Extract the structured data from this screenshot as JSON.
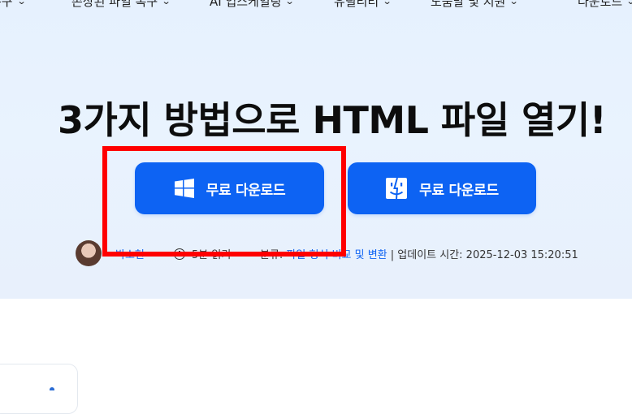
{
  "nav": {
    "items": [
      {
        "label": "복구"
      },
      {
        "label": "손상된 파일 복구"
      },
      {
        "label": "AI 업스케일링"
      },
      {
        "label": "유틸리티"
      },
      {
        "label": "도움말 및 지원"
      },
      {
        "label": "다운로드"
      }
    ]
  },
  "hero": {
    "title": "3가지 방법으로 HTML 파일 열기!",
    "buttons": {
      "windows_label": "무료 다운로드",
      "mac_label": "무료 다운로드"
    }
  },
  "meta": {
    "author": "박소현",
    "read_time": "5분 읽기",
    "category_prefix": "분류:",
    "category_link": "파일 형식 비교 및 변환",
    "updated": "| 업데이트 시간: 2025-12-03 15:20:51"
  },
  "colors": {
    "accent": "#0d63f3",
    "highlight": "#ff0000",
    "hero_bg": "#e6f1fe"
  },
  "icons": {
    "windows": "windows-logo-icon",
    "mac": "finder-logo-icon",
    "clock": "clock-icon",
    "chevron": "chevron-down-icon"
  }
}
